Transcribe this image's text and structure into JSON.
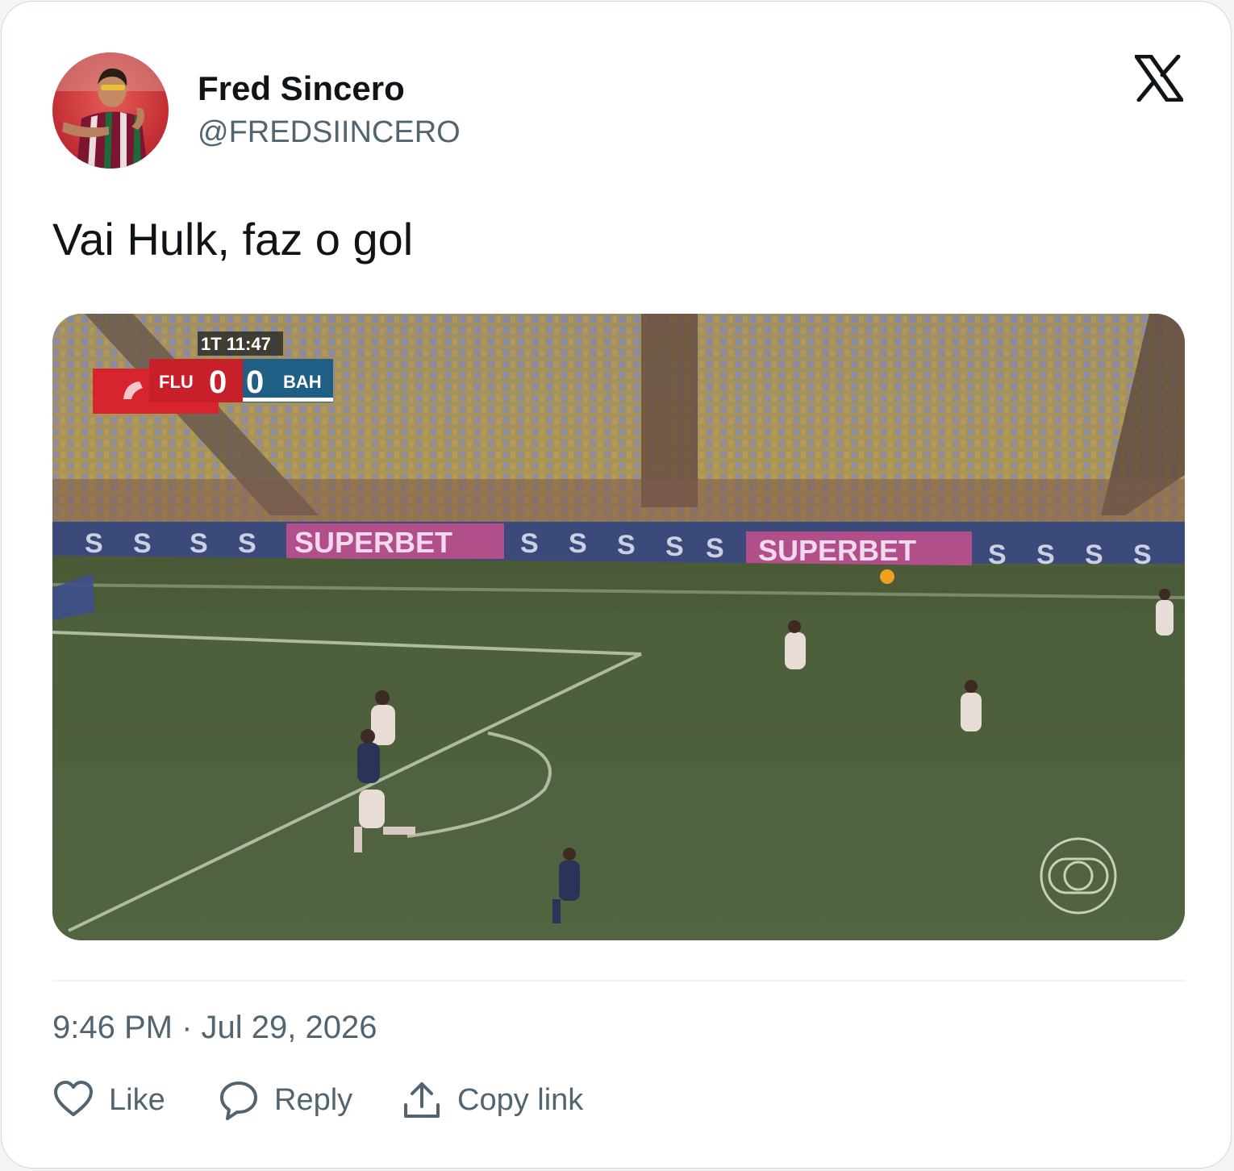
{
  "author": {
    "name": "Fred Sincero",
    "handle": "@FREDSIINCERO"
  },
  "tweet": {
    "text": "Vai Hulk, faz o gol"
  },
  "video": {
    "clock": "1T 11:47",
    "home_team": "FLU",
    "home_score": "0",
    "away_score": "0",
    "away_team": "BAH",
    "board_text": "SUPERBET",
    "board_letter": "S"
  },
  "meta": {
    "timestamp": "9:46 PM · Jul 29, 2026"
  },
  "actions": {
    "like": "Like",
    "reply": "Reply",
    "copy_link": "Copy link"
  },
  "icons": {
    "brand": "x-logo",
    "like": "heart-icon",
    "reply": "speech-bubble-icon",
    "share": "upload-arrow-icon",
    "broadcaster": "globo-logo-icon"
  },
  "colors": {
    "text_primary": "#0f1419",
    "text_secondary": "#536471",
    "border": "#cfd9de",
    "pitch": "#4d5f3a"
  }
}
